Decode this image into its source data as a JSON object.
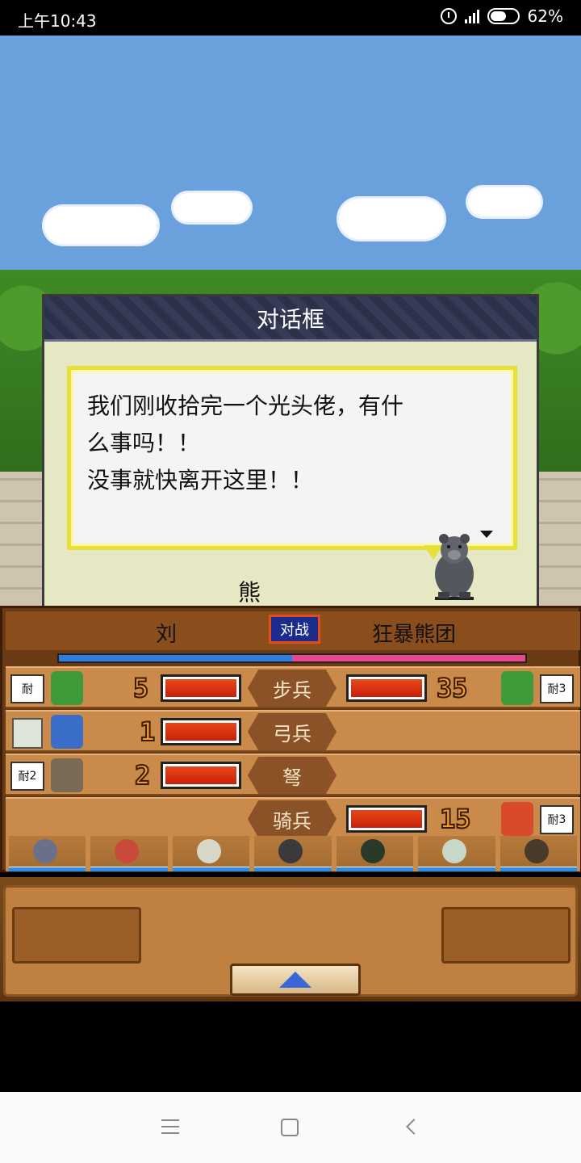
{
  "status_bar": {
    "time": "上午10:43",
    "battery": "62%",
    "battery_level": 0.62
  },
  "dialog": {
    "title": "对话框",
    "lines": [
      "我们刚收拾完一个光头佬，有什",
      "么事吗！！",
      "没事就快离开这里！！"
    ],
    "speaker": "熊"
  },
  "battle": {
    "left_name": "刘",
    "vs_label": "对战",
    "right_name": "狂暴熊团",
    "morale_left": 0.5,
    "badge_label": "耐",
    "rows": [
      {
        "unit": "步兵",
        "left_count": "5",
        "right_count": "35",
        "left_badge_num": "",
        "right_badge_num": "3"
      },
      {
        "unit": "弓兵",
        "left_count": "1",
        "right_count": "",
        "left_badge_num": "",
        "right_badge_num": ""
      },
      {
        "unit": "弩",
        "left_count": "2",
        "right_count": "",
        "left_badge_num": "2",
        "right_badge_num": ""
      },
      {
        "unit": "骑兵",
        "left_count": "",
        "right_count": "15",
        "left_badge_num": "",
        "right_badge_num": "3"
      }
    ]
  },
  "colors": {
    "sky": "#6aa0dc",
    "dialog_bg": "#e6e8c4",
    "bubble_border": "#e6e03a",
    "bar_red": "#e8481a",
    "morale_blue": "#2d7ee0",
    "morale_pink": "#e8488c"
  }
}
